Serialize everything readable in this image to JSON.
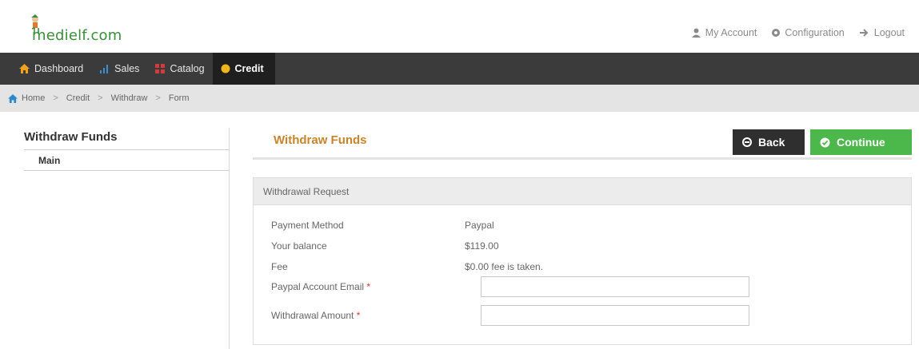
{
  "brand": {
    "logo_text": "medielf.com"
  },
  "top_links": [
    {
      "label": "My Account",
      "icon": "user-icon"
    },
    {
      "label": "Configuration",
      "icon": "gear-icon"
    },
    {
      "label": "Logout",
      "icon": "logout-icon"
    }
  ],
  "nav": [
    {
      "label": "Dashboard",
      "icon": "home-icon",
      "icon_color": "#f0a21a"
    },
    {
      "label": "Sales",
      "icon": "bar-chart-icon",
      "icon_color": "#3c8fd0"
    },
    {
      "label": "Catalog",
      "icon": "catalog-icon",
      "icon_color": "#d33b3b"
    },
    {
      "label": "Credit",
      "icon": "credit-icon",
      "icon_color": "#f2b51c"
    }
  ],
  "breadcrumb": [
    "Home",
    "Credit",
    "Withdraw",
    "Form"
  ],
  "sidebar": {
    "title": "Withdraw Funds",
    "items": [
      "Main"
    ]
  },
  "main": {
    "title": "Withdraw Funds",
    "back_label": "Back",
    "continue_label": "Continue",
    "panel_title": "Withdrawal Request",
    "fields": [
      {
        "label": "Payment Method",
        "value": "Paypal"
      },
      {
        "label": "Your balance",
        "value": "$119.00"
      },
      {
        "label": "Fee",
        "value": "$0.00 fee is taken."
      },
      {
        "label": "Paypal Account Email",
        "required": "*",
        "value": ""
      },
      {
        "label": "Withdrawal Amount",
        "required": "*",
        "value": ""
      }
    ]
  },
  "colors": {
    "accent": "#c8842c",
    "continue": "#4cb74a",
    "navbar": "#3b3b3b"
  }
}
